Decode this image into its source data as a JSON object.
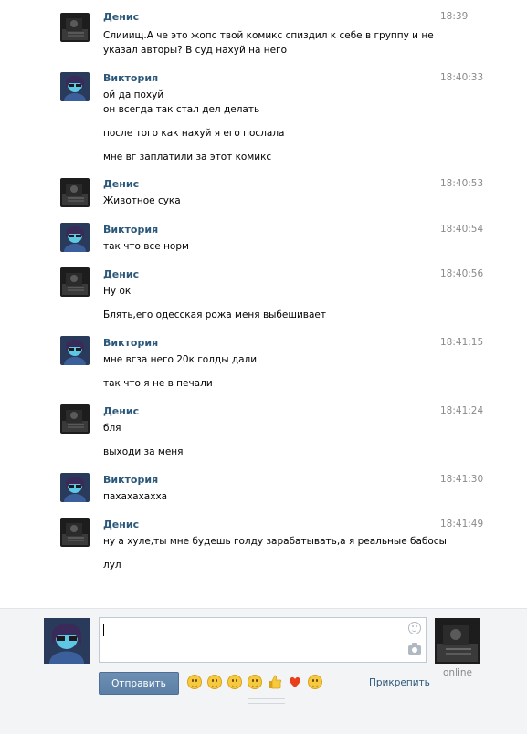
{
  "messages": [
    {
      "author": "Денис",
      "side": "denis",
      "time": "18:39",
      "lines": [
        "Слииищ.А че это жопс твой комикс спиздил к себе в группу и не",
        "указал авторы? В суд нахуй на него"
      ]
    },
    {
      "author": "Виктория",
      "side": "viktoria",
      "time": "18:40:33",
      "lines": [
        "ой да похуй",
        "он всегда так стал дел делать",
        "после того как нахуй я его послала",
        "мне вг заплатили за этот комикс"
      ]
    },
    {
      "author": "Денис",
      "side": "denis",
      "time": "18:40:53",
      "lines": [
        "Животное сука"
      ]
    },
    {
      "author": "Виктория",
      "side": "viktoria",
      "time": "18:40:54",
      "lines": [
        "так что все норм"
      ]
    },
    {
      "author": "Денис",
      "side": "denis",
      "time": "18:40:56",
      "lines": [
        "Ну ок",
        "Блять,его одесская рожа меня выбешивает"
      ]
    },
    {
      "author": "Виктория",
      "side": "viktoria",
      "time": "18:41:15",
      "lines": [
        "мне вгза него 20к голды дали",
        "так что я не в печали"
      ]
    },
    {
      "author": "Денис",
      "side": "denis",
      "time": "18:41:24",
      "lines": [
        "бля",
        "выходи за меня"
      ]
    },
    {
      "author": "Виктория",
      "side": "viktoria",
      "time": "18:41:30",
      "lines": [
        "пахахахахха"
      ]
    },
    {
      "author": "Денис",
      "side": "denis",
      "time": "18:41:49",
      "lines": [
        "ну а хуле,ты мне будешь голду зарабатывать,а я реальные бабосы",
        "лул"
      ]
    }
  ],
  "composer": {
    "value": "",
    "send_label": "Отправить",
    "attach_label": "Прикрепить",
    "peer_status": "online",
    "emojis": [
      "tired-face-emoji",
      "grin-emoji",
      "wink-tongue-emoji",
      "relieved-emoji",
      "thumbs-up-emoji",
      "heart-emoji",
      "kiss-emoji"
    ]
  },
  "colors": {
    "author": "#2b587a",
    "time": "#8a8a8a",
    "send_button": "#5b7fa6",
    "bottom_bar": "#f3f4f6"
  }
}
